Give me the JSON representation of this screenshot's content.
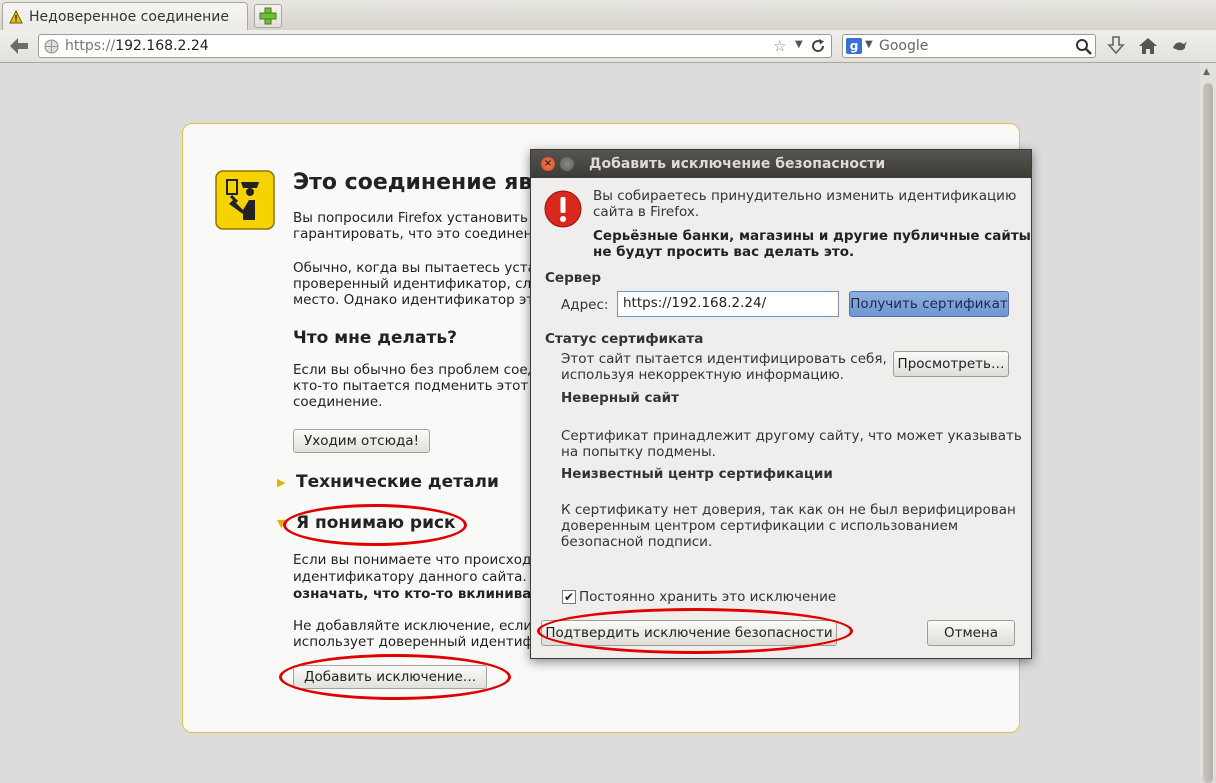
{
  "browser": {
    "tab_title": "Недоверенное соединение",
    "url_protocol": "https://",
    "url_host": "192.168.2.24",
    "search_placeholder": "Google"
  },
  "error_page": {
    "title": "Это соединение явл",
    "p1": "Вы попросили Firefox установить\nгарантировать, что это соединени",
    "p2": "Обычно, когда вы пытаетесь устан\nпроверенный идентификатор, слу\nместо. Однако идентификатор эт",
    "what_to_do": "Что мне делать?",
    "p3": "Если вы обычно без проблем соед\nкто-то пытается подменить этот с\nсоединение.",
    "get_me_out": "Уходим отсюда!",
    "technical_details": "Технические детали",
    "understand_risk": "Я понимаю риск",
    "p4_line1": "Если вы понимаете что происходи",
    "p4_line2": "идентификатору данного сайта. Д",
    "p4_line3": "означать, что кто-то вклинивает",
    "p5": "Не добавляйте исключение, если\nиспользует доверенный идентиф",
    "add_exception": "Добавить исключение…"
  },
  "dialog": {
    "title": "Добавить исключение безопасности",
    "intro": "Вы собираетесь принудительно изменить идентификацию\nсайта в Firefox.",
    "warning_bold": "Серьёзные банки, магазины и другие публичные сайты\nне будут просить вас делать это.",
    "server_label": "Сервер",
    "address_label": "Адрес:",
    "address_value": "https://192.168.2.24/",
    "get_cert_button": "Получить сертификат",
    "cert_status_label": "Статус сертификата",
    "cert_status_text": "Этот сайт пытается идентифицировать себя,\nиспользуя некорректную информацию.",
    "view_button": "Просмотреть…",
    "wrong_site_title": "Неверный сайт",
    "wrong_site_text": "Сертификат принадлежит другому сайту, что может указывать\nна попытку подмены.",
    "unknown_ca_title": "Неизвестный центр сертификации",
    "unknown_ca_text": "К сертификату нет доверия, так как он не был верифицирован\nдоверенным центром сертификации с использованием\nбезопасной подписи.",
    "permanent_label": "Постоянно хранить это исключение",
    "permanent_checked": true,
    "confirm_button": "Подтвердить исключение безопасности",
    "cancel_button": "Отмена"
  },
  "colors": {
    "annotation_red": "#e00000",
    "dialog_accent_blue": "#6f95d3",
    "error_border": "#e5c14a"
  }
}
